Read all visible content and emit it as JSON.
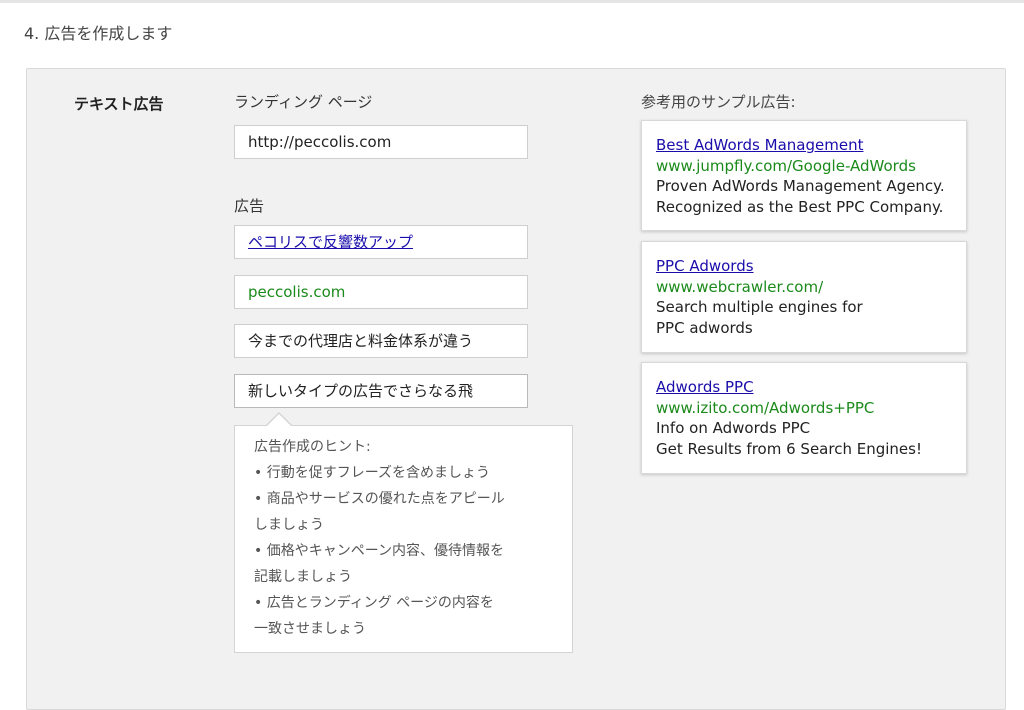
{
  "step_title": "4. 広告を作成します",
  "section_label": "テキスト広告",
  "landing": {
    "label": "ランディング ページ",
    "value": "http://peccolis.com"
  },
  "ad": {
    "label": "広告",
    "headline": "ペコリスで反響数アップ",
    "display_url": "peccolis.com",
    "line1": "今までの代理店と料金体系が違う",
    "line2": "新しいタイプの広告でさらなる飛"
  },
  "tips": {
    "title": "広告作成のヒント:",
    "lines": [
      "• 行動を促すフレーズを含めましょう",
      "• 商品やサービスの優れた点をアピール",
      "しましょう",
      "• 価格やキャンペーン内容、優待情報を",
      "記載しましょう",
      "• 広告とランディング ページの内容を",
      "一致させましょう"
    ]
  },
  "samples": {
    "label": "参考用のサンプル広告:",
    "ads": [
      {
        "headline": "Best AdWords Management",
        "url": "www.jumpfly.com/Google-AdWords",
        "desc1": "Proven AdWords Management Agency.",
        "desc2": "Recognized as the Best PPC Company."
      },
      {
        "headline": "PPC Adwords",
        "url": "www.webcrawler.com/",
        "desc1": "Search multiple engines for",
        "desc2": "PPC adwords"
      },
      {
        "headline": "Adwords PPC",
        "url": "www.izito.com/Adwords+PPC",
        "desc1": "Info on Adwords PPC",
        "desc2": "Get Results from 6 Search Engines!"
      }
    ]
  },
  "colors": {
    "link": "#1a0dab",
    "url_green": "#1b8a1b",
    "panel_bg": "#f1f1f1"
  }
}
